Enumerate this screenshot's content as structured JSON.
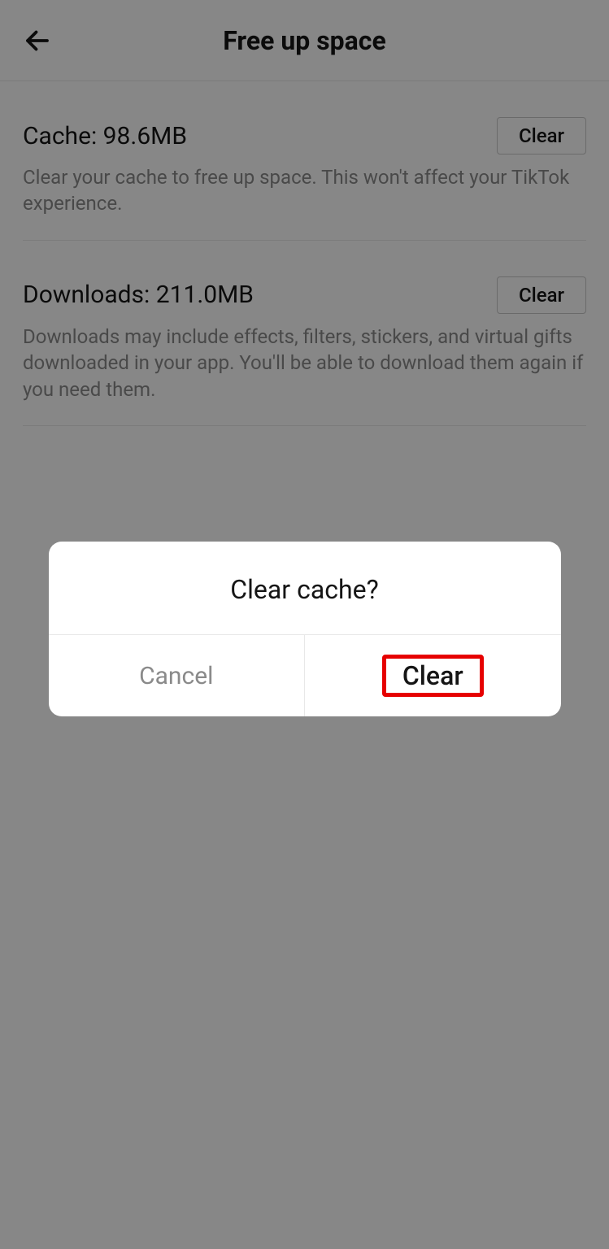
{
  "header": {
    "title": "Free up space"
  },
  "sections": {
    "cache": {
      "title": "Cache: 98.6MB",
      "description": "Clear your cache to free up space. This won't affect your TikTok experience.",
      "buttonLabel": "Clear"
    },
    "downloads": {
      "title": "Downloads: 211.0MB",
      "description": "Downloads may include effects, filters, stickers, and virtual gifts downloaded in your app. You'll be able to download them again if you need them.",
      "buttonLabel": "Clear"
    }
  },
  "dialog": {
    "title": "Clear cache?",
    "cancelLabel": "Cancel",
    "confirmLabel": "Clear"
  }
}
